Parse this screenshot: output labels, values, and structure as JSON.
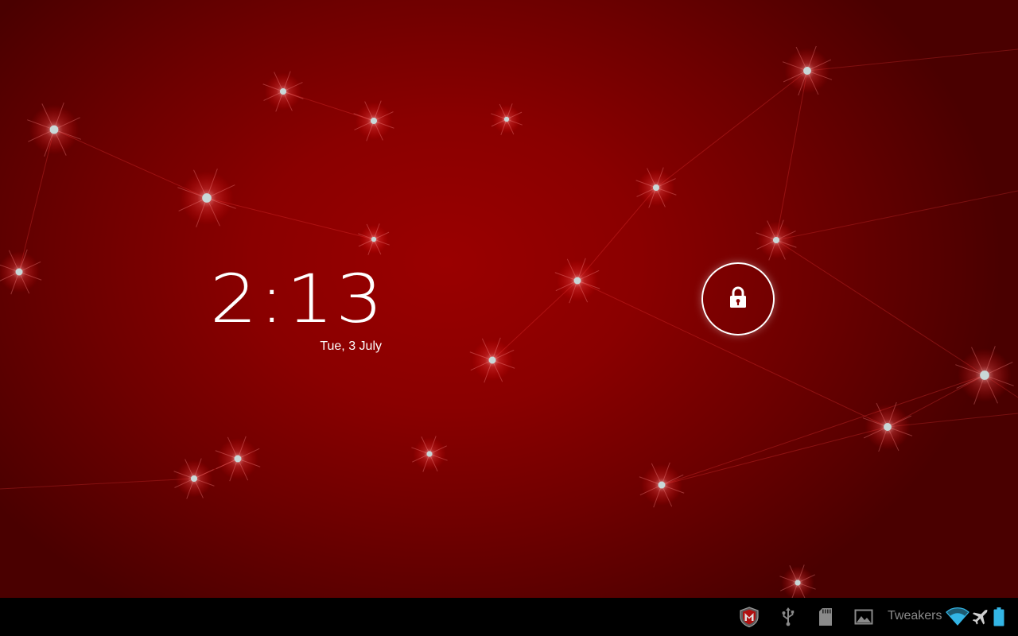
{
  "lockscreen": {
    "time": "2:13",
    "date": "Tue, 3 July"
  },
  "unlock": {
    "icon": "lock-icon"
  },
  "status_bar": {
    "notification_icons": [
      "mcafee-icon",
      "usb-icon",
      "sd-card-icon",
      "gallery-icon"
    ],
    "carrier": "Tweakers",
    "system_icons": [
      "wifi-icon",
      "airplane-mode-icon",
      "battery-icon"
    ],
    "accent_color": "#33b5e5"
  },
  "theme": {
    "wallpaper_color": "#8a0000",
    "star_color": "#c8d8d8"
  }
}
